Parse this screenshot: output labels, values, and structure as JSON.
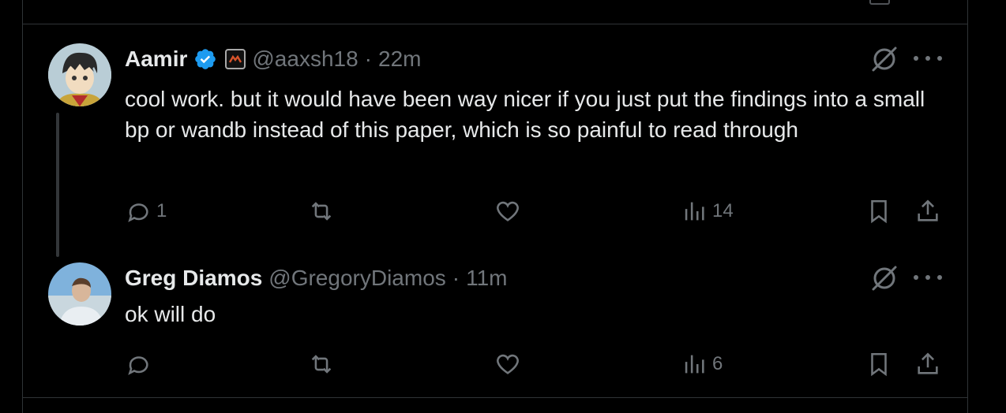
{
  "tweets": [
    {
      "name": "Aamir",
      "handle": "@aaxsh18",
      "sep": "·",
      "time": "22m",
      "text": "cool work. but it would have been way nicer if you just put the findings into a small bp or wandb instead of this paper, which is so painful to read through",
      "verified": true,
      "replies": "1",
      "views": "14"
    },
    {
      "name": "Greg Diamos",
      "handle": "@GregoryDiamos",
      "sep": "·",
      "time": "11m",
      "text": "ok will do",
      "verified": false,
      "replies": "",
      "views": "6"
    }
  ],
  "colors": {
    "background": "#000000",
    "text": "#e7e9ea",
    "muted": "#71767b",
    "border": "#2f3336",
    "verified": "#1d9bf0"
  },
  "icons": [
    "reply-icon",
    "retweet-icon",
    "like-icon",
    "views-icon",
    "bookmark-icon",
    "share-icon",
    "grok-icon",
    "more-icon",
    "verified-badge-icon"
  ]
}
